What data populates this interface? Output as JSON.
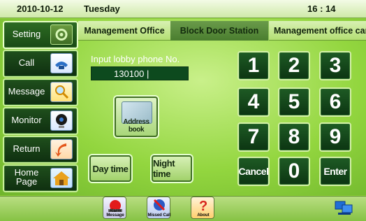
{
  "status": {
    "date": "2010-10-12",
    "weekday": "Tuesday",
    "time": "16 : 14"
  },
  "sidebar": {
    "items": [
      {
        "label": "Setting",
        "icon": "gear-icon"
      },
      {
        "label": "Call",
        "icon": "phone-icon"
      },
      {
        "label": "Message",
        "icon": "magnifier-icon"
      },
      {
        "label": "Monitor",
        "icon": "camera-icon"
      },
      {
        "label": "Return",
        "icon": "return-arrow-icon"
      },
      {
        "label": "Home Page",
        "icon": "home-icon"
      }
    ]
  },
  "tabs": [
    {
      "label": "Management Office"
    },
    {
      "label": "Block Door Station"
    },
    {
      "label": "Management office camera"
    }
  ],
  "phone": {
    "label": "Input lobby phone No.",
    "value": "130100 |"
  },
  "address_book": {
    "label": "Address book"
  },
  "time_buttons": {
    "day": "Day time",
    "night": "Night time"
  },
  "keypad": {
    "keys": [
      "1",
      "2",
      "3",
      "4",
      "5",
      "6",
      "7",
      "8",
      "9",
      "Cancel",
      "0",
      "Enter"
    ]
  },
  "bottom": {
    "alarm": "Alarm Message",
    "missed": "Missed Call",
    "about": "About"
  },
  "colors": {
    "accent_green": "#8fd13a",
    "button_dark": "#0f3a14"
  }
}
